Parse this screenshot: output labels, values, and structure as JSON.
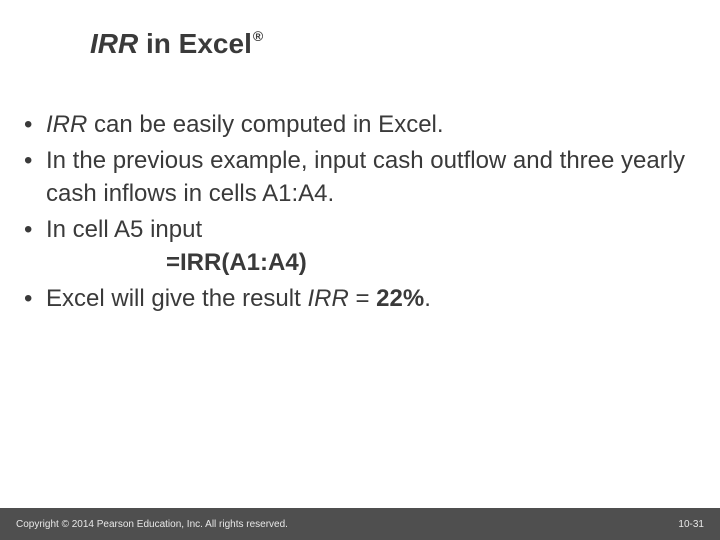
{
  "title": {
    "italic_part": "IRR",
    "rest": " in Excel",
    "reg": "®"
  },
  "bullets": {
    "b1_pre": "",
    "b1_italic": "IRR",
    "b1_post": " can be easily computed in Excel.",
    "b2": "In the previous example, input cash outflow and three yearly cash inflows in cells A1:A4.",
    "b3": "In cell A5 input",
    "b3_formula": "=IRR(A1:A4)",
    "b4_pre": "Excel will give the result ",
    "b4_italic": "IRR",
    "b4_mid": " = ",
    "b4_bold": "22%",
    "b4_post": "."
  },
  "footer": {
    "copyright": "Copyright © 2014 Pearson Education, Inc. All rights reserved.",
    "page": "10-31"
  }
}
